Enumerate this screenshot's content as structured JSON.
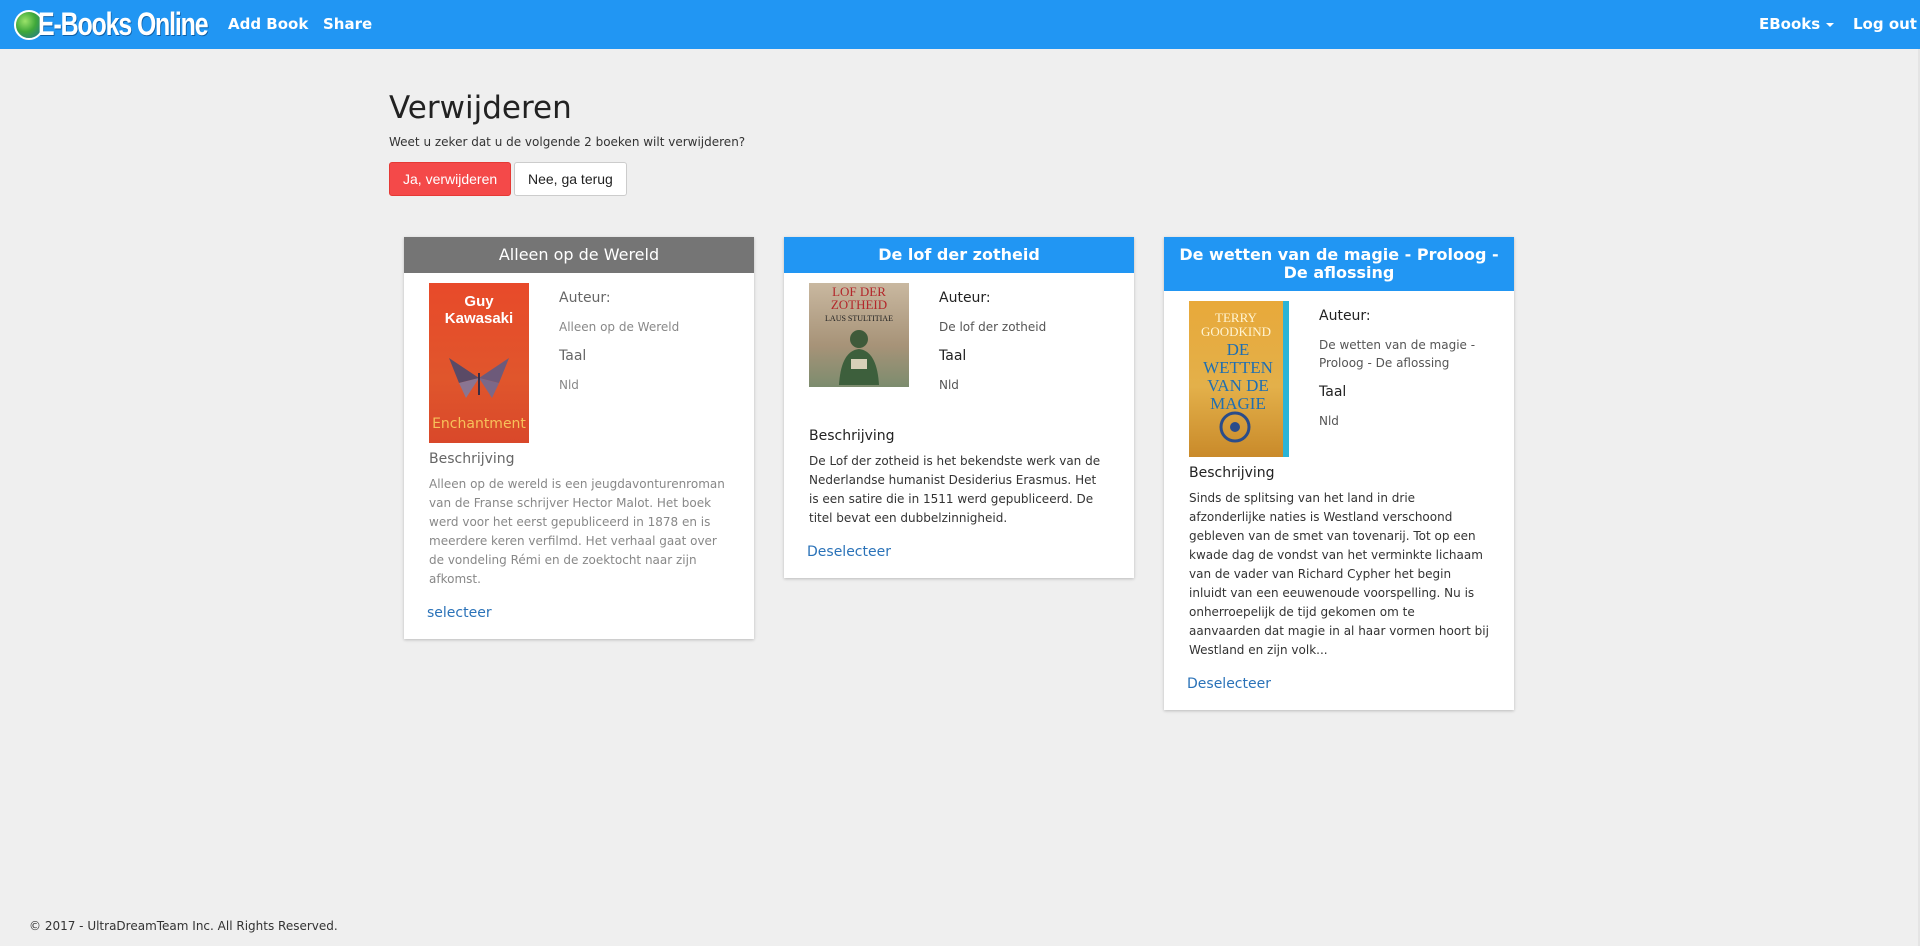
{
  "brand": {
    "name": "E-Books Online"
  },
  "nav": {
    "add_book": "Add Book",
    "share": "Share",
    "ebooks": "EBooks",
    "logout": "Log out"
  },
  "page": {
    "title": "Verwijderen",
    "confirm": "Weet u zeker dat u de volgende 2 boeken wilt verwijderen?",
    "yes_label": "Ja, verwijderen",
    "no_label": "Nee, ga terug"
  },
  "labels": {
    "author": "Auteur:",
    "language": "Taal",
    "description": "Beschrijving"
  },
  "books": [
    {
      "title": "Alleen op de Wereld",
      "author": "Alleen op de Wereld",
      "language": "Nld",
      "description": "Alleen op de wereld is een jeugdavonturenroman van de Franse schrijver Hector Malot. Het boek werd voor het eerst gepubliceerd in 1878 en is meerdere keren verfilmd. Het verhaal gaat over de vondeling Rémi en de zoektocht naar zijn afkomst.",
      "action": "selecteer",
      "cover_top": "Guy Kawasaki",
      "cover_bottom": "Enchantment"
    },
    {
      "title": "De lof der zotheid",
      "author": "De lof der zotheid",
      "language": "Nld",
      "description": "De Lof der zotheid is het bekendste werk van de Nederlandse humanist Desiderius Erasmus. Het is een satire die in 1511 werd gepubliceerd. De titel bevat een dubbelzinnigheid.",
      "action": "Deselecteer",
      "cover_top": "LOF DER ZOTHEID",
      "cover_bottom": "LAUS STULTITIAE"
    },
    {
      "title": "De wetten van de magie - Proloog - De aflossing",
      "author": "De wetten van de magie - Proloog - De aflossing",
      "language": "Nld",
      "description": "Sinds de splitsing van het land in drie afzonderlijke naties is Westland verschoond gebleven van de smet van tovenarij. Tot op een kwade dag de vondst van het verminkte lichaam van de vader van Richard Cypher het begin inluidt van een eeuwenoude voorspelling. Nu is onherroepelijk de tijd gekomen om te aanvaarden dat magie in al haar vormen hoort bij Westland en zijn volk...",
      "action": "Deselecteer",
      "cover_top": "TERRY GOODKIND",
      "cover_bottom": "DE WETTEN VAN DE MAGIE"
    }
  ],
  "footer": {
    "text": "© 2017 - UltraDreamTeam Inc. All Rights Reserved."
  },
  "colors": {
    "navbar": "#2196f3",
    "danger": "#f44949",
    "header_grey": "#757575",
    "link": "#2a72b8"
  }
}
